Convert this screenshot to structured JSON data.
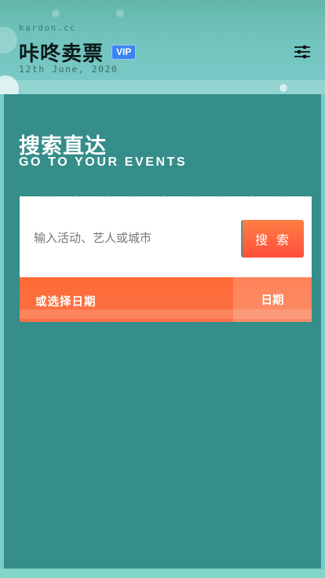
{
  "header": {
    "site": "kardon.cc",
    "app_title": "咔咚卖票",
    "badge": "VIP",
    "date": "12th June, 2020",
    "settings_icon": "sliders-icon"
  },
  "hero": {
    "title": "搜索直达",
    "subtitle": "GO TO YOUR EVENTS"
  },
  "search": {
    "placeholder": "输入活动、艺人或城市",
    "button_label": "搜 索"
  },
  "date_picker": {
    "label": "或选择日期",
    "button_label": "日期"
  },
  "colors": {
    "accent": "#ff5a3a",
    "main_bg": "#358e8a",
    "header_bg": "#71c4bd",
    "vip": "#3a86f0"
  }
}
